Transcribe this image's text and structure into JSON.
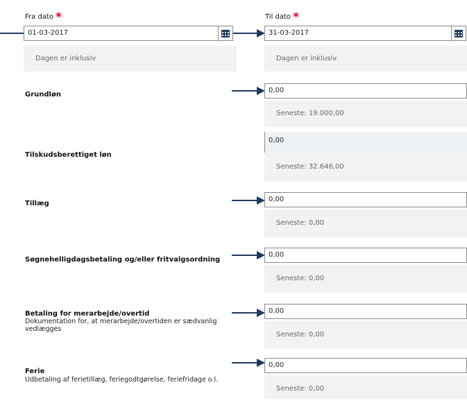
{
  "from_date": {
    "label": "Fra dato",
    "required_mark": "*",
    "value": "01-03-2017",
    "hint": "Dagen er inklusiv"
  },
  "to_date": {
    "label": "Til dato",
    "required_mark": "*",
    "value": "31-03-2017",
    "hint": "Dagen er inklusiv"
  },
  "rows": [
    {
      "label": "Grundløn",
      "value": "0,00",
      "hint": "Seneste: 19.000,00"
    },
    {
      "label": "Tilskudsberettiget løn",
      "value": "0,00",
      "hint": "Seneste: 32.646,00"
    },
    {
      "label": "Tillæg",
      "value": "0,00",
      "hint": "Seneste: 0,00"
    },
    {
      "label": "Søgnehelligdagsbetaling og/eller fritvalgsordning",
      "value": "0,00",
      "hint": "Seneste: 0,00"
    },
    {
      "label": "Betaling for merarbejde/overtid",
      "sublabel": "Dokumentation for, at merarbejde/overtiden er sædvanlig vedlægges",
      "value": "0,00",
      "hint": "Seneste: 0,00"
    },
    {
      "label": "Ferie",
      "sublabel": "Udbetaling af ferietillæg, feriegodtgørelse, feriefridage o.l.",
      "value": "0,00",
      "hint": "Seneste: 0,00"
    }
  ],
  "colors": {
    "arrow": "#1f3a5f",
    "required": "#e4002b",
    "calendar": "#1f3a5f"
  }
}
